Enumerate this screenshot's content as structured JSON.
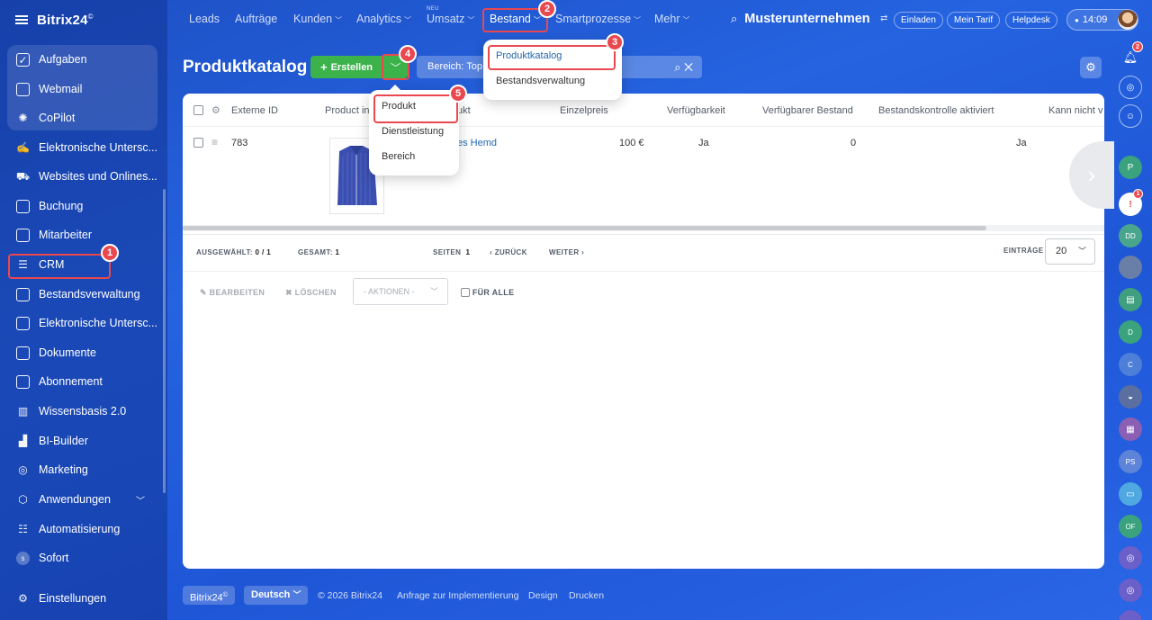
{
  "app": {
    "name": "Bitrix24",
    "reg": "©"
  },
  "sidebar": {
    "items": [
      {
        "label": "Aufgaben",
        "icon": "check-square-icon"
      },
      {
        "label": "Webmail",
        "icon": "mail-icon"
      },
      {
        "label": "CoPilot",
        "icon": "copilot-icon"
      },
      {
        "label": "Elektronische Untersc...",
        "icon": "signature-icon"
      },
      {
        "label": "Websites und Onlines...",
        "icon": "cart-icon"
      },
      {
        "label": "Buchung",
        "icon": "calendar-icon"
      },
      {
        "label": "Mitarbeiter",
        "icon": "id-card-icon"
      },
      {
        "label": "CRM",
        "icon": "funnel-icon"
      },
      {
        "label": "Bestandsverwaltung",
        "icon": "warehouse-icon"
      },
      {
        "label": "Elektronische Untersc...",
        "icon": "document-sign-icon"
      },
      {
        "label": "Dokumente",
        "icon": "document-icon"
      },
      {
        "label": "Abonnement",
        "icon": "subscription-icon"
      },
      {
        "label": "Wissensbasis 2.0",
        "icon": "books-icon"
      },
      {
        "label": "BI-Builder",
        "icon": "bar-chart-icon"
      },
      {
        "label": "Marketing",
        "icon": "target-icon"
      },
      {
        "label": "Anwendungen",
        "icon": "cube-icon"
      },
      {
        "label": "Automatisierung",
        "icon": "robot-icon"
      },
      {
        "label": "Sofort",
        "icon": "s-circle-icon"
      },
      {
        "label": "Einstellungen",
        "icon": "gear-icon"
      }
    ]
  },
  "nav": {
    "leads": "Leads",
    "orders": "Aufträge",
    "customers": "Kunden",
    "analytics": "Analytics",
    "sales": "Umsatz",
    "neu": "NEU",
    "stock": "Bestand",
    "smart": "Smartprozesse",
    "more": "Mehr"
  },
  "header": {
    "company": "Musterunternehmen",
    "invite": "Einladen",
    "tariff": "Mein Tarif",
    "help": "Helpdesk",
    "time": "14:09"
  },
  "page": {
    "title": "Produktkatalog",
    "create": "Erstellen",
    "filter": "Bereich: Top"
  },
  "table": {
    "columns": [
      "Externe ID",
      "Product in",
      "ukt",
      "Einzelpreis",
      "Verfügbarkeit",
      "Verfügbarer Bestand",
      "Bestandskontrolle aktiviert",
      "Kann nicht v"
    ],
    "row": {
      "id": "783",
      "name": "es Hemd",
      "price": "100 €",
      "availability": "Ja",
      "stock": "0",
      "cannot": "Ja"
    }
  },
  "footer_bar": {
    "selected_label": "AUSGEWÄHLT:",
    "selected": "0 / 1",
    "total_label": "GESAMT:",
    "total": "1",
    "pages_label": "SEITEN",
    "page": "1",
    "back": "ZURÜCK",
    "next": "WEITER",
    "entries_label": "EINTRÄGE",
    "per_page": "20"
  },
  "actions": {
    "edit": "BEARBEITEN",
    "delete": "LÖSCHEN",
    "select": "- AKTIONEN -",
    "for_all": "FÜR ALLE"
  },
  "stock_menu": {
    "items": [
      "Produktkatalog",
      "Bestandsverwaltung"
    ]
  },
  "create_menu": {
    "items": [
      "Produkt",
      "Dienstleistung",
      "Bereich"
    ]
  },
  "badges": [
    "1",
    "2",
    "3",
    "4",
    "5"
  ],
  "rightbar": {
    "notif_count": "2",
    "alert_count": "1",
    "avatars": [
      "P",
      "DD",
      "D",
      "C",
      "PS",
      "OF"
    ]
  },
  "footer": {
    "brand": "Bitrix24",
    "lang": "Deutsch",
    "copyright": "© 2026 Bitrix24",
    "impl": "Anfrage zur Implementierung",
    "design": "Design",
    "print": "Drucken"
  },
  "colors": {
    "accent": "#2067b0",
    "green": "#3bb34a",
    "callout": "#e9484f"
  }
}
